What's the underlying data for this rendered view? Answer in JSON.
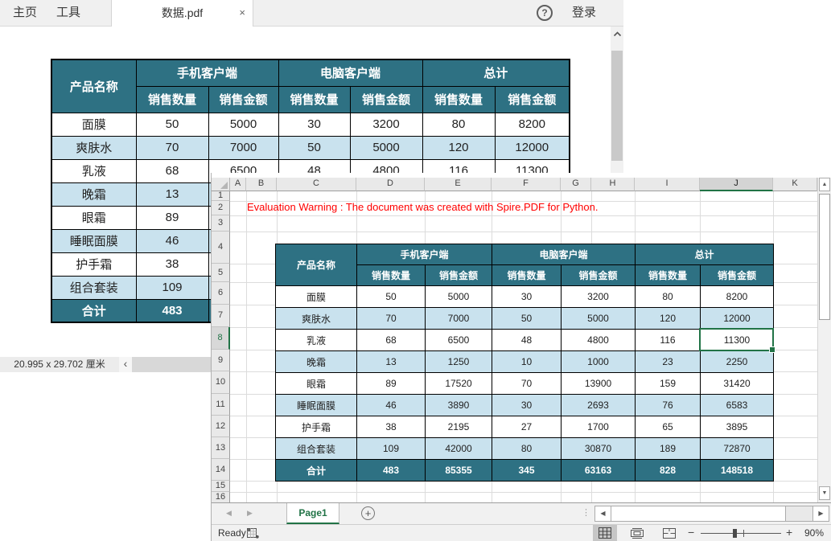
{
  "pdf_viewer": {
    "menu_home": "主页",
    "menu_tools": "工具",
    "tab_title": "数据.pdf",
    "login_label": "登录",
    "page_size": "20.995 x 29.702 厘米"
  },
  "table": {
    "product_header": "产品名称",
    "group_headers": [
      "手机客户端",
      "电脑客户端",
      "总计"
    ],
    "sub_headers": [
      "销售数量",
      "销售金额",
      "销售数量",
      "销售金额",
      "销售数量",
      "销售金额"
    ],
    "rows": [
      {
        "name": "面膜",
        "values": [
          "50",
          "5000",
          "30",
          "3200",
          "80",
          "8200"
        ]
      },
      {
        "name": "爽肤水",
        "values": [
          "70",
          "7000",
          "50",
          "5000",
          "120",
          "12000"
        ]
      },
      {
        "name": "乳液",
        "values": [
          "68",
          "6500",
          "48",
          "4800",
          "116",
          "11300"
        ]
      },
      {
        "name": "晚霜",
        "values": [
          "13",
          "1250",
          "10",
          "1000",
          "23",
          "2250"
        ]
      },
      {
        "name": "眼霜",
        "values": [
          "89",
          "17520",
          "70",
          "13900",
          "159",
          "31420"
        ]
      },
      {
        "name": "睡眠面膜",
        "values": [
          "46",
          "3890",
          "30",
          "2693",
          "76",
          "6583"
        ]
      },
      {
        "name": "护手霜",
        "values": [
          "38",
          "2195",
          "27",
          "1700",
          "65",
          "3895"
        ]
      },
      {
        "name": "组合套装",
        "values": [
          "109",
          "42000",
          "80",
          "30870",
          "189",
          "72870"
        ]
      },
      {
        "name": "合计",
        "values": [
          "483",
          "85355",
          "345",
          "63163",
          "828",
          "148518"
        ],
        "total": true
      }
    ]
  },
  "excel": {
    "warning_text": "Evaluation Warning : The document was created with Spire.PDF for Python.",
    "column_headers": [
      "A",
      "B",
      "C",
      "D",
      "E",
      "F",
      "G",
      "H",
      "I",
      "J",
      "K"
    ],
    "row_headers": [
      "1",
      "2",
      "3",
      "4",
      "5",
      "6",
      "7",
      "8",
      "9",
      "10",
      "11",
      "12",
      "13",
      "14",
      "15",
      "16"
    ],
    "selection": {
      "column": "J",
      "row": "8"
    },
    "sheet_tab_label": "Page1",
    "status_ready": "Ready",
    "zoom_level": "90%"
  },
  "icons": {
    "help": "?",
    "close_tab": "×",
    "collapse_left": "‹",
    "scroll_up": "▲",
    "scroll_down": "▼",
    "scroll_left": "◀",
    "scroll_right": "▶",
    "sheet_prev": "◀",
    "sheet_next": "▶",
    "add_sheet": "+",
    "more_dots": "⋮",
    "zoom_out": "−",
    "zoom_in": "+"
  },
  "colors": {
    "header_teal": "#2e7183",
    "row_blue": "#c9e2ee",
    "excel_green": "#217346",
    "warning_red": "#ff0000"
  }
}
